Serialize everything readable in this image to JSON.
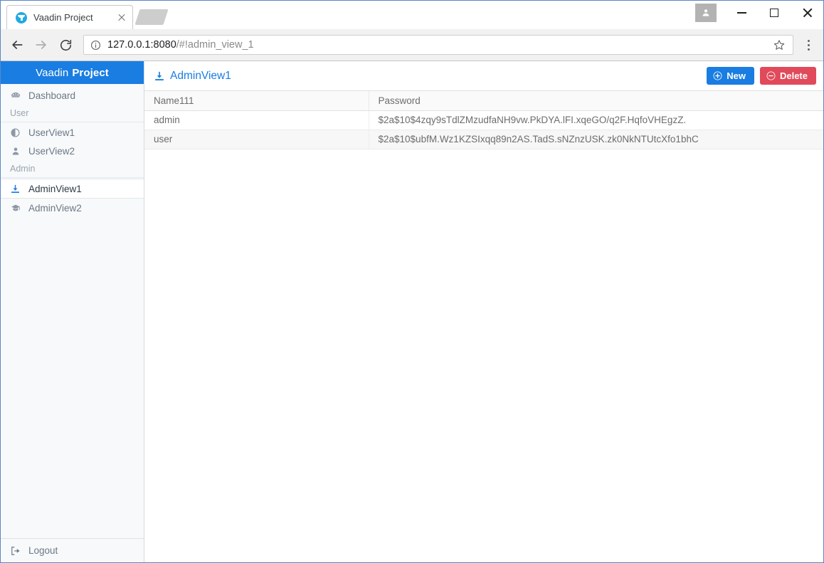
{
  "browser": {
    "tab": {
      "title": "Vaadin Project",
      "favicon": "vaadin-logo-icon",
      "close_icon": "close-icon"
    },
    "new_tab_button": "new-tab-button",
    "window_controls": {
      "profile": "user-avatar-icon",
      "minimize": "minimize-icon",
      "maximize": "maximize-icon",
      "close": "close-icon"
    },
    "toolbar": {
      "back": "back-arrow-icon",
      "forward": "forward-arrow-icon",
      "reload": "reload-icon",
      "site_info": "info-circle-icon",
      "url_host": "127.0.0.1:8080",
      "url_path": "/#!admin_view_1",
      "url_full": "127.0.0.1:8080/#!admin_view_1",
      "bookmark": "star-icon",
      "menu": "three-dots-menu-icon"
    }
  },
  "sidebar": {
    "brand_light": "Vaadin",
    "brand_bold": "Project",
    "items": [
      {
        "label": "Dashboard",
        "icon": "dashboard-icon",
        "active": false
      },
      {
        "label": "User",
        "type": "section"
      },
      {
        "label": "UserView1",
        "icon": "adjust-icon",
        "active": false
      },
      {
        "label": "UserView2",
        "icon": "user-icon",
        "active": false
      },
      {
        "label": "Admin",
        "type": "section"
      },
      {
        "label": "AdminView1",
        "icon": "download-icon",
        "active": true
      },
      {
        "label": "AdminView2",
        "icon": "academy-cap-icon",
        "active": false
      }
    ],
    "footer": {
      "label": "Logout",
      "icon": "sign-out-icon"
    }
  },
  "main": {
    "view_title": "AdminView1",
    "view_title_icon": "download-icon",
    "buttons": {
      "new": {
        "label": "New",
        "icon": "plus-circle-icon",
        "color": "#197de1"
      },
      "delete": {
        "label": "Delete",
        "icon": "minus-circle-icon",
        "color": "#e04a5a"
      }
    },
    "table": {
      "columns": [
        "Name111",
        "Password"
      ],
      "rows": [
        [
          "admin",
          "$2a$10$4zqy9sTdlZMzudfaNH9vw.PkDYA.lFI.xqeGO/q2F.HqfoVHEgzZ."
        ],
        [
          "user",
          "$2a$10$ubfM.Wz1KZSIxqq89n2AS.TadS.sNZnzUSK.zk0NkNTUtcXfo1bhC"
        ]
      ]
    }
  }
}
